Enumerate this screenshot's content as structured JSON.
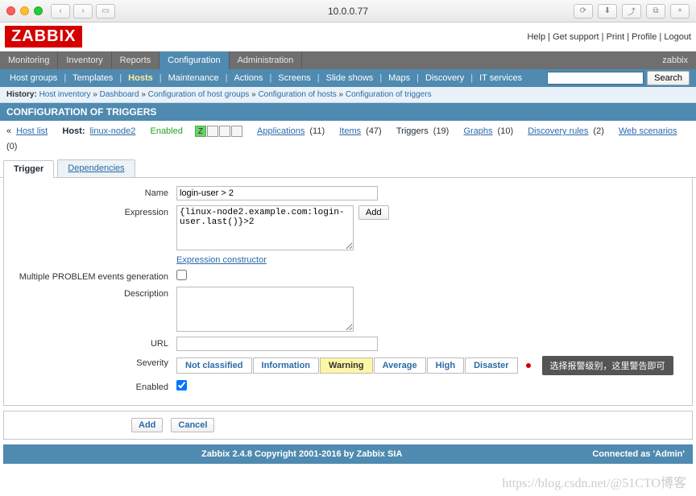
{
  "browser": {
    "url": "10.0.0.77"
  },
  "topLinks": {
    "help": "Help",
    "support": "Get support",
    "print": "Print",
    "profile": "Profile",
    "logout": "Logout"
  },
  "mainMenu": {
    "monitoring": "Monitoring",
    "inventory": "Inventory",
    "reports": "Reports",
    "configuration": "Configuration",
    "administration": "Administration",
    "user": "zabbix"
  },
  "subMenu": {
    "hostGroups": "Host groups",
    "templates": "Templates",
    "hosts": "Hosts",
    "maintenance": "Maintenance",
    "actions": "Actions",
    "screens": "Screens",
    "slideShows": "Slide shows",
    "maps": "Maps",
    "discovery": "Discovery",
    "itServices": "IT services",
    "search": "Search"
  },
  "history": {
    "label": "History:",
    "hostInventory": "Host inventory",
    "dashboard": "Dashboard",
    "confHostGroups": "Configuration of host groups",
    "confHosts": "Configuration of hosts",
    "confTriggers": "Configuration of triggers"
  },
  "sectionTitle": "CONFIGURATION OF TRIGGERS",
  "hostBar": {
    "hostList": "Host list",
    "hostLabel": "Host:",
    "hostName": "linux-node2",
    "enabled": "Enabled",
    "applications": "Applications",
    "appCount": "(11)",
    "items": "Items",
    "itemCount": "(47)",
    "triggers": "Triggers",
    "trigCount": "(19)",
    "graphs": "Graphs",
    "graphCount": "(10)",
    "discovery": "Discovery rules",
    "discCount": "(2)",
    "web": "Web scenarios",
    "webCount": "(0)"
  },
  "tabs": {
    "trigger": "Trigger",
    "dependencies": "Dependencies"
  },
  "form": {
    "nameLabel": "Name",
    "nameValue": "login-user > 2",
    "exprLabel": "Expression",
    "exprValue": "{linux-node2.example.com:login-user.last()}>2",
    "addBtn": "Add",
    "exprConstructor": "Expression constructor",
    "multipleLabel": "Multiple PROBLEM events generation",
    "descLabel": "Description",
    "urlLabel": "URL",
    "severityLabel": "Severity",
    "sev": {
      "notClassified": "Not classified",
      "information": "Information",
      "warning": "Warning",
      "average": "Average",
      "high": "High",
      "disaster": "Disaster"
    },
    "tooltip": "选择报警级别，这里警告即可",
    "enabledLabel": "Enabled"
  },
  "buttonBar": {
    "add": "Add",
    "cancel": "Cancel"
  },
  "footer": {
    "copyright": "Zabbix 2.4.8 Copyright 2001-2016 by Zabbix SIA",
    "connected": "Connected as 'Admin'"
  },
  "watermark": "https://blog.csdn.net/@51CTO博客"
}
